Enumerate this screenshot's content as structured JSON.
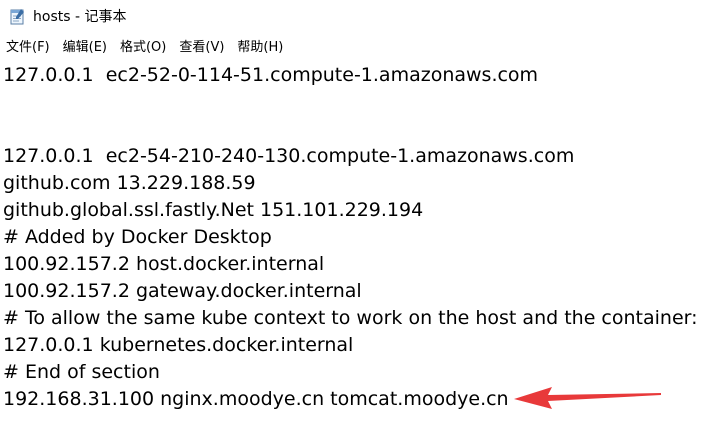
{
  "window": {
    "title": "hosts - 记事本",
    "icon": "notepad-icon"
  },
  "menu": {
    "items": [
      {
        "name": "menu-file",
        "label": "文件(F)"
      },
      {
        "name": "menu-edit",
        "label": "编辑(E)"
      },
      {
        "name": "menu-format",
        "label": "格式(O)"
      },
      {
        "name": "menu-view",
        "label": "查看(V)"
      },
      {
        "name": "menu-help",
        "label": "帮助(H)"
      }
    ]
  },
  "editor": {
    "lines": [
      "127.0.0.1  ec2-52-0-114-51.compute-1.amazonaws.com",
      "",
      "",
      "127.0.0.1  ec2-54-210-240-130.compute-1.amazonaws.com",
      "github.com 13.229.188.59",
      "github.global.ssl.fastly.Net 151.101.229.194",
      "# Added by Docker Desktop",
      "100.92.157.2 host.docker.internal",
      "100.92.157.2 gateway.docker.internal",
      "# To allow the same kube context to work on the host and the container:",
      "127.0.0.1 kubernetes.docker.internal",
      "# End of section",
      "192.168.31.100 nginx.moodye.cn tomcat.moodye.cn"
    ]
  },
  "annotation": {
    "arrow_color": "#e8393a",
    "icon": "red-arrow-icon"
  }
}
